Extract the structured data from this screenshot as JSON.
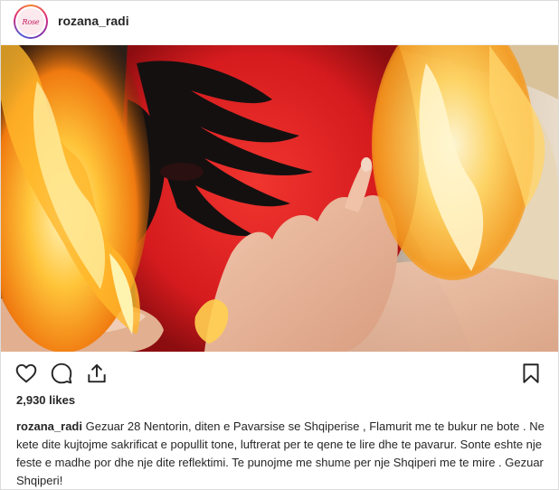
{
  "post": {
    "username": "rozana_radi",
    "avatar_text": "Rose",
    "likes": "2,930 likes",
    "caption_user": "rozana_radi",
    "caption_text": "Gezuar 28 Nentorin, diten e Pavarsise se Shqiperise , Flamurit me te bukur ne bote . Ne kete dite kujtojme sakrificat e popullit tone, luftrerat per te qene te lire dhe te pavarur. Sonte eshte nje feste e madhe por dhe nje dite reflektimi. Te punojme me shume per nje Shqiperi me te mire . Gezuar Shqiperi!"
  },
  "icons": {
    "like": "heart-icon",
    "comment": "comment-icon",
    "share": "share-icon",
    "save": "bookmark-icon"
  },
  "colors": {
    "text": "#262626",
    "border": "#dbdbdb",
    "flag_red": "#e41e20"
  }
}
